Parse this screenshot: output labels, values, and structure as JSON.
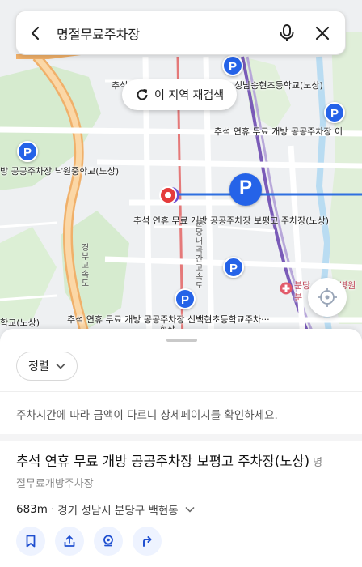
{
  "search": {
    "query": "명절무료주차장"
  },
  "map": {
    "research_label": "이 지역 재검색",
    "labels": {
      "top_school": "성남송현초등학교(노상)",
      "top_left": "추석",
      "right_lot": "추석 연휴 무료 개방 공공주차장 이",
      "left_school": "방 공공주차장 낙원중학교(노상)",
      "selected_lot": "추석 연휴 무료 개방 공공주차장 보평고 주차장(노상)",
      "bottom_lot": "추석 연휴 무료 개방 공공주차장 신백현초등학교주차···",
      "bottom_left": "학교(노상)",
      "highway": "경부고속도",
      "road": "분당내곡간고속도",
      "hospital": "분당",
      "hospital2": "병원",
      "hospital3": "분",
      "current": "현상"
    },
    "pin_glyph": "P"
  },
  "sheet": {
    "sort_label": "정렬",
    "notice": "주차시간에 따라 금액이 다르니 상세페이지를 확인하세요.",
    "result": {
      "title": "추석 연휴 무료 개방 공공주차장 보평고 주차장(노상)",
      "category_part1": "명",
      "category_part2": "절무료개방주차장",
      "distance": "683m",
      "address": "경기 성남시 분당구 백현동"
    }
  },
  "colors": {
    "accent": "#2563e8",
    "route": "#2f6fe0"
  },
  "icons": [
    "back-arrow-icon",
    "microphone-icon",
    "close-icon",
    "refresh-icon",
    "location-target-icon",
    "chevron-down-icon",
    "bookmark-icon",
    "share-icon",
    "pin-icon",
    "directions-icon",
    "parking-icon"
  ]
}
